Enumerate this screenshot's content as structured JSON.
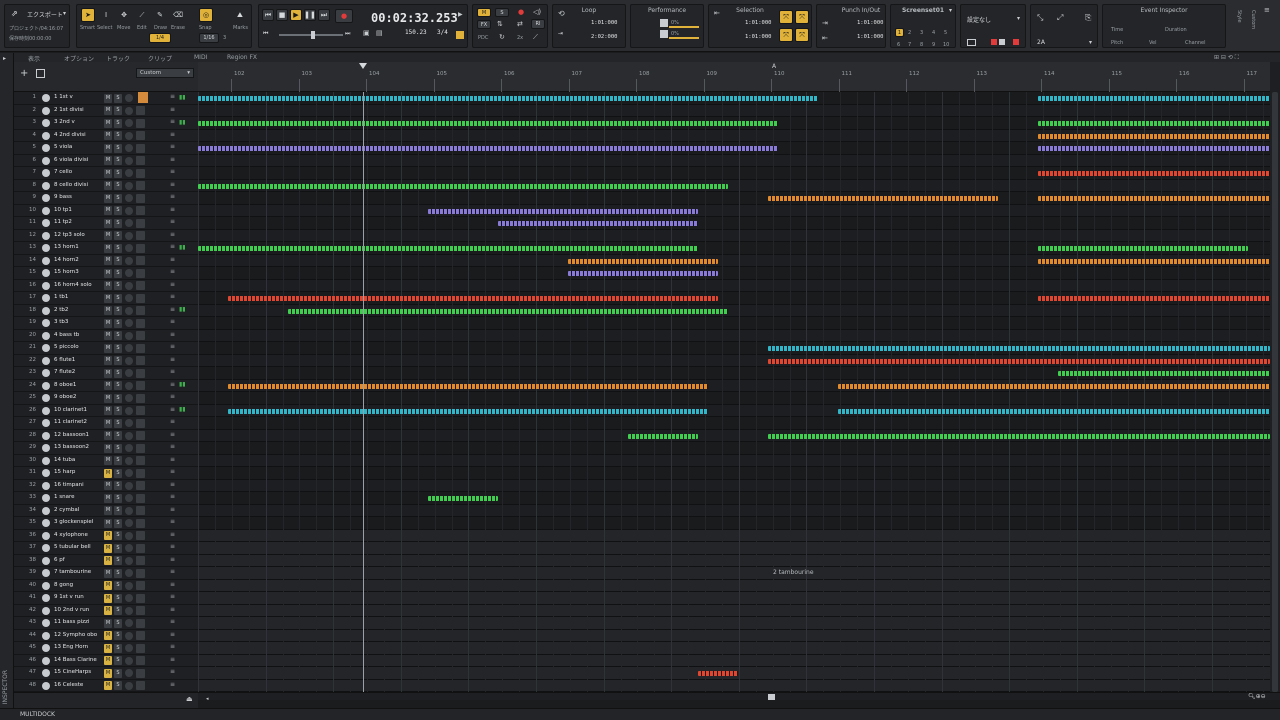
{
  "control_bar": {
    "export_label": "エクスポート",
    "project_info": "プロジェクト/04:16:07",
    "status_info": "保存時刻00:00:00",
    "tools": {
      "smart": "Smart",
      "select": "Select",
      "move": "Move",
      "edit": "Edit",
      "draw": "Draw",
      "erase": "Erase",
      "snap": "Snap",
      "marks": "Marks",
      "snap_value": "1/4",
      "snap_value2": "1/16",
      "snap_num": "3"
    },
    "transport": {
      "time": "00:02:32.253",
      "tempo": "150.23",
      "meter": "3/4"
    },
    "mix": {
      "m": "M",
      "s": "S",
      "fx": "FX",
      "pdc": "PDC",
      "ri": "RI",
      "speed": "2x"
    },
    "loop": {
      "title": "Loop",
      "start": "1:01:000",
      "end": "2:02:000"
    },
    "performance": {
      "title": "Performance",
      "val1": "0%",
      "val2": "0%"
    },
    "selection": {
      "title": "Selection",
      "start": "1:01:000",
      "end": "1:01:000"
    },
    "punch": {
      "title": "Punch In/Out",
      "start": "1:01:000",
      "end": "1:01:000"
    },
    "screenset": {
      "title": "Screenset01",
      "nums": [
        "1",
        "2",
        "3",
        "4",
        "5",
        "6",
        "7",
        "8",
        "9",
        "10"
      ]
    },
    "preset": {
      "label": "設定なし",
      "value": "2A"
    },
    "event_inspector": {
      "title": "Event Inspector",
      "time": "Time",
      "duration": "Duration",
      "pitch": "Pitch",
      "vel": "Vel",
      "channel": "Channel"
    },
    "right_labels": {
      "style": "Style",
      "custom": "Custom"
    }
  },
  "menu": {
    "view": "表示",
    "options": "オプション",
    "track": "トラック",
    "clip": "クリップ",
    "midi": "MIDI",
    "region_fx": "Region FX"
  },
  "track_toolbar": {
    "preset": "Custom"
  },
  "ruler": {
    "labels": [
      "102",
      "103",
      "104",
      "105",
      "106",
      "107",
      "108",
      "109",
      "110",
      "111",
      "112",
      "113",
      "114",
      "115",
      "116",
      "117"
    ],
    "loop_marker": "A"
  },
  "tracks": [
    {
      "num": "1",
      "name": "1 1st v",
      "mute": false
    },
    {
      "num": "2",
      "name": "2 1st divisi",
      "mute": false
    },
    {
      "num": "3",
      "name": "3 2nd v",
      "mute": false
    },
    {
      "num": "4",
      "name": "4 2nd divisi",
      "mute": false
    },
    {
      "num": "5",
      "name": "5 viola",
      "mute": false
    },
    {
      "num": "6",
      "name": "6 viola divisi",
      "mute": false
    },
    {
      "num": "7",
      "name": "7 cello",
      "mute": false
    },
    {
      "num": "8",
      "name": "8 cello divisi",
      "mute": false
    },
    {
      "num": "9",
      "name": "9 bass",
      "mute": false
    },
    {
      "num": "10",
      "name": "10 tp1",
      "mute": false
    },
    {
      "num": "11",
      "name": "11 tp2",
      "mute": false
    },
    {
      "num": "12",
      "name": "12 tp3 solo",
      "mute": false
    },
    {
      "num": "13",
      "name": "13 horn1",
      "mute": false
    },
    {
      "num": "14",
      "name": "14 horn2",
      "mute": false
    },
    {
      "num": "15",
      "name": "15 horn3",
      "mute": false
    },
    {
      "num": "16",
      "name": "16 horn4 solo",
      "mute": false
    },
    {
      "num": "17",
      "name": "1 tb1",
      "mute": false
    },
    {
      "num": "18",
      "name": "2 tb2",
      "mute": false
    },
    {
      "num": "19",
      "name": "3 tb3",
      "mute": false
    },
    {
      "num": "20",
      "name": "4 bass tb",
      "mute": false
    },
    {
      "num": "21",
      "name": "5 piccolo",
      "mute": false
    },
    {
      "num": "22",
      "name": "6 flute1",
      "mute": false
    },
    {
      "num": "23",
      "name": "7 flute2",
      "mute": false
    },
    {
      "num": "24",
      "name": "8 oboe1",
      "mute": false
    },
    {
      "num": "25",
      "name": "9 oboe2",
      "mute": false
    },
    {
      "num": "26",
      "name": "10 clarinet1",
      "mute": false
    },
    {
      "num": "27",
      "name": "11 clarinet2",
      "mute": false
    },
    {
      "num": "28",
      "name": "12 bassoon1",
      "mute": false
    },
    {
      "num": "29",
      "name": "13 bassoon2",
      "mute": false
    },
    {
      "num": "30",
      "name": "14 tuba",
      "mute": false
    },
    {
      "num": "31",
      "name": "15 harp",
      "mute": true
    },
    {
      "num": "32",
      "name": "16 timpani",
      "mute": false
    },
    {
      "num": "33",
      "name": "1 snare",
      "mute": false
    },
    {
      "num": "34",
      "name": "2 cymbal",
      "mute": false
    },
    {
      "num": "35",
      "name": "3 glockenspiel",
      "mute": false
    },
    {
      "num": "36",
      "name": "4 xylophone",
      "mute": true
    },
    {
      "num": "37",
      "name": "5 tubular bell",
      "mute": true
    },
    {
      "num": "38",
      "name": "6 pf",
      "mute": true
    },
    {
      "num": "39",
      "name": "7 tambourine",
      "mute": false
    },
    {
      "num": "40",
      "name": "8 gong",
      "mute": true
    },
    {
      "num": "41",
      "name": "9 1st v run",
      "mute": true
    },
    {
      "num": "42",
      "name": "10 2nd v run",
      "mute": true
    },
    {
      "num": "43",
      "name": "11 bass pizzi",
      "mute": false
    },
    {
      "num": "44",
      "name": "12 Sympho obo",
      "mute": true
    },
    {
      "num": "45",
      "name": "13 Eng Horn",
      "mute": true
    },
    {
      "num": "46",
      "name": "14 Bass Clarine",
      "mute": true
    },
    {
      "num": "47",
      "name": "15 CineHarps",
      "mute": true
    },
    {
      "num": "48",
      "name": "16 Celeste",
      "mute": true
    }
  ],
  "clip_labels": {
    "tambourine": "2 tambourine"
  },
  "inspector_label": "INSPECTOR",
  "multidock_label": "MULTIDOCK",
  "colors": {
    "cyan": "#2fb7c9",
    "green": "#3fcf4f",
    "purple": "#8a7ad8",
    "orange": "#e38b2a",
    "red": "#e2462f",
    "accent": "#e0b23a"
  }
}
